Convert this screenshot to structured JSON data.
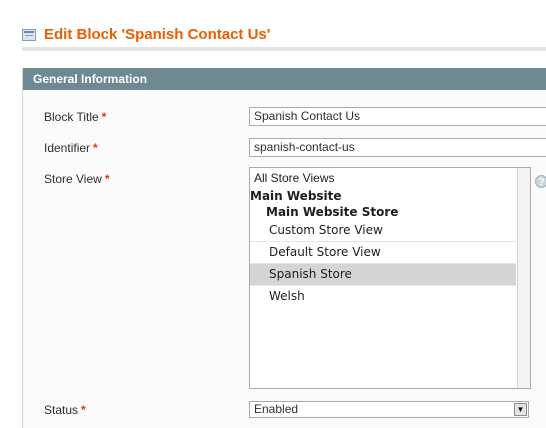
{
  "page": {
    "title": "Edit Block 'Spanish Contact Us'",
    "title_icon": "cms-block-icon"
  },
  "fieldset": {
    "header": "General Information"
  },
  "form": {
    "required_marker": "*",
    "block_title": {
      "label": "Block Title",
      "value": "Spanish Contact Us"
    },
    "identifier": {
      "label": "Identifier",
      "value": "spanish-contact-us"
    },
    "store_view": {
      "label": "Store View",
      "options": [
        {
          "text": "All Store Views",
          "type": "option",
          "selected": false
        },
        {
          "text": "Main Website",
          "type": "group",
          "selected": false
        },
        {
          "text": "Main Website Store",
          "type": "group",
          "selected": false
        },
        {
          "text": "Custom Store View",
          "type": "option",
          "selected": false
        },
        {
          "text": "Default Store View",
          "type": "option",
          "selected": false
        },
        {
          "text": "Spanish Store",
          "type": "option",
          "selected": true
        },
        {
          "text": "Welsh",
          "type": "option",
          "selected": false
        }
      ],
      "help_icon": "help-icon",
      "help_glyph": "?"
    },
    "status": {
      "label": "Status",
      "value": "Enabled",
      "arrow": "▼"
    }
  },
  "colors": {
    "title": "#eb5e00",
    "header_bg": "#6f8992",
    "required": "#eb340a",
    "selected_bg": "#d4d4d4"
  }
}
